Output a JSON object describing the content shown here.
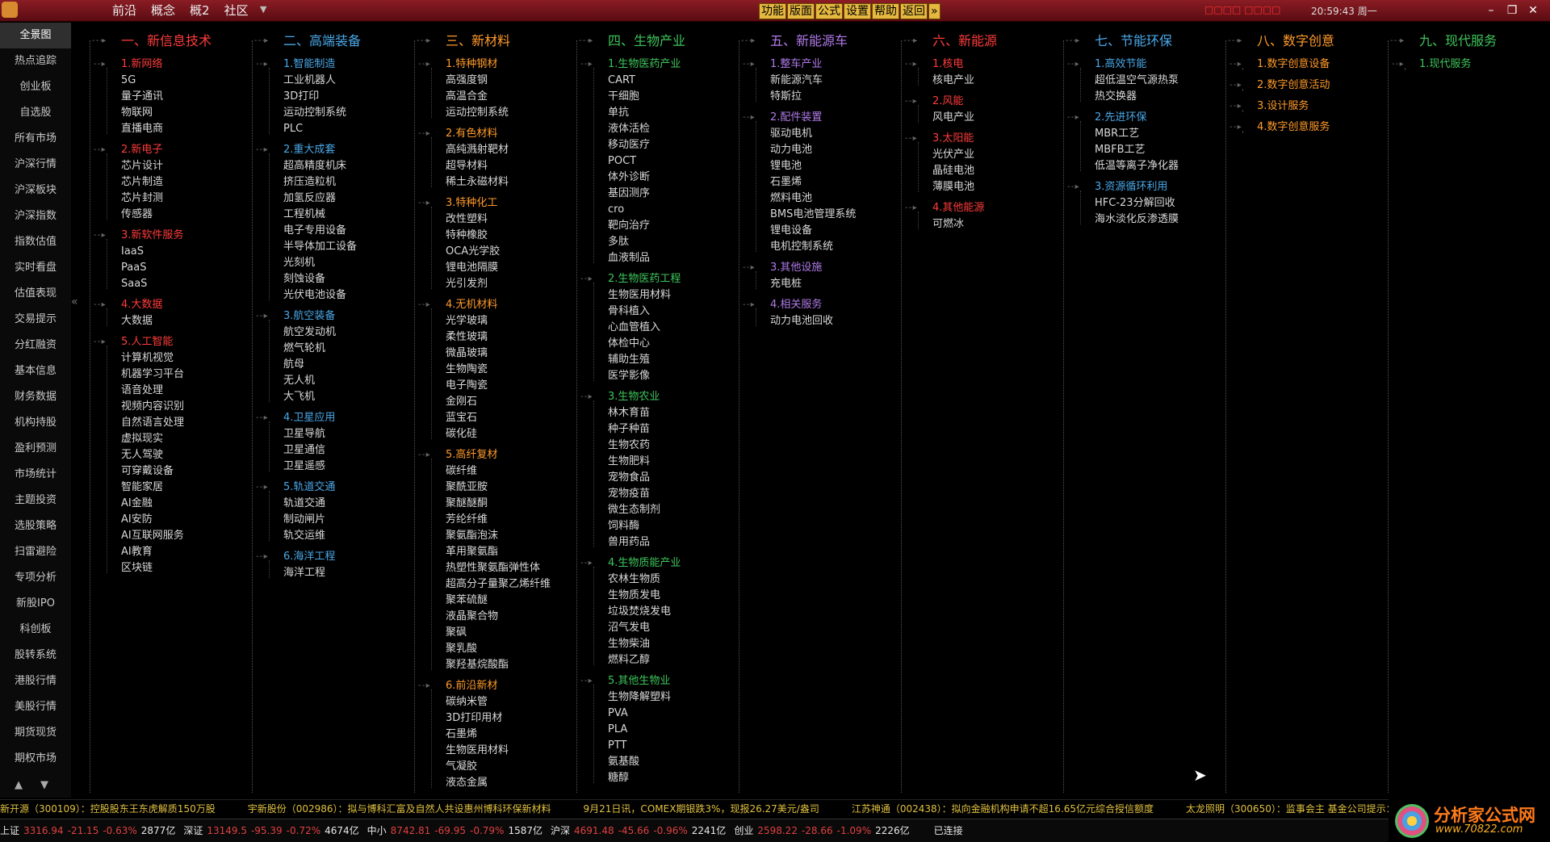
{
  "titlebar": {
    "menu": [
      "前沿",
      "概念",
      "概2",
      "社区"
    ],
    "func_buttons": [
      "功能",
      "版面",
      "公式",
      "设置",
      "帮助",
      "返回"
    ],
    "more_icon": "»",
    "notice": "□□□□ □□□□",
    "clock": "20:59:43 周一",
    "window_controls": [
      "–",
      "❐",
      "✕"
    ]
  },
  "sidebar": {
    "items": [
      "全景图",
      "热点追踪",
      "创业板",
      "自选股",
      "所有市场",
      "沪深行情",
      "沪深板块",
      "沪深指数",
      "指数估值",
      "实时看盘",
      "估值表现",
      "交易提示",
      "分红融资",
      "基本信息",
      "财务数据",
      "机构持股",
      "盈利预测",
      "市场统计",
      "主题投资",
      "选股策略",
      "扫雷避险",
      "专项分析",
      "新股IPO",
      "科创板",
      "股转系统",
      "港股行情",
      "美股行情",
      "期货现货",
      "期权市场"
    ],
    "active": "全景图",
    "collapse_icon": "«",
    "nav_up": "▲",
    "nav_down": "▼"
  },
  "colors": {
    "cat_red": "#ff3b3b",
    "sub_red": "#ff3b3b",
    "cat_blue": "#4aa8e8",
    "sub_blue": "#4aa8e8",
    "cat_orange": "#ff9a2a",
    "sub_orange": "#ff9a2a",
    "cat_green": "#3ec45a",
    "sub_green": "#3ec45a",
    "cat_purple": "#b07ae8",
    "sub_purple": "#b07ae8",
    "cat_teal": "#3ec45a",
    "sub_teal": "#3ec45a"
  },
  "tree": [
    {
      "title": "一、新信息技术",
      "color": "red",
      "subs": [
        {
          "title": "1.新网络",
          "leaves": [
            "5G",
            "量子通讯",
            "物联网",
            "直播电商"
          ]
        },
        {
          "title": "2.新电子",
          "leaves": [
            "芯片设计",
            "芯片制造",
            "芯片封测",
            "传感器"
          ]
        },
        {
          "title": "3.新软件服务",
          "leaves": [
            "IaaS",
            "PaaS",
            "SaaS"
          ]
        },
        {
          "title": "4.大数据",
          "leaves": [
            "大数据"
          ]
        },
        {
          "title": "5.人工智能",
          "leaves": [
            "计算机视觉",
            "机器学习平台",
            "语音处理",
            "视频内容识别",
            "自然语言处理",
            "虚拟现实",
            "无人驾驶",
            "可穿戴设备",
            "智能家居",
            "AI金融",
            "AI安防",
            "AI互联网服务",
            "AI教育",
            "区块链"
          ]
        }
      ]
    },
    {
      "title": "二、高端装备",
      "color": "blue",
      "subs": [
        {
          "title": "1.智能制造",
          "leaves": [
            "工业机器人",
            "3D打印",
            "运动控制系统",
            "PLC"
          ]
        },
        {
          "title": "2.重大成套",
          "leaves": [
            "超高精度机床",
            "挤压造粒机",
            "加氢反应器",
            "工程机械",
            "电子专用设备",
            "半导体加工设备",
            "光刻机",
            "刻蚀设备",
            "光伏电池设备"
          ]
        },
        {
          "title": "3.航空装备",
          "leaves": [
            "航空发动机",
            "燃气轮机",
            "航母",
            "无人机",
            "大飞机"
          ]
        },
        {
          "title": "4.卫星应用",
          "leaves": [
            "卫星导航",
            "卫星通信",
            "卫星遥感"
          ]
        },
        {
          "title": "5.轨道交通",
          "leaves": [
            "轨道交通",
            "制动闸片",
            "轨交运维"
          ]
        },
        {
          "title": "6.海洋工程",
          "leaves": [
            "海洋工程"
          ]
        }
      ]
    },
    {
      "title": "三、新材料",
      "color": "orange",
      "subs": [
        {
          "title": "1.特种钢材",
          "leaves": [
            "高强度钢",
            "高温合金",
            "运动控制系统"
          ]
        },
        {
          "title": "2.有色材料",
          "leaves": [
            "高纯溅射靶材",
            "超导材料",
            "稀土永磁材料"
          ]
        },
        {
          "title": "3.特种化工",
          "leaves": [
            "改性塑料",
            "特种橡胶",
            "OCA光学胶",
            "锂电池隔膜",
            "光引发剂"
          ]
        },
        {
          "title": "4.无机材料",
          "leaves": [
            "光学玻璃",
            "柔性玻璃",
            "微晶玻璃",
            "生物陶瓷",
            "电子陶瓷",
            "金刚石",
            "蓝宝石",
            "碳化硅"
          ]
        },
        {
          "title": "5.高纤复材",
          "leaves": [
            "碳纤维",
            "聚酰亚胺",
            "聚醚醚酮",
            "芳纶纤维",
            "聚氨酯泡沫",
            "革用聚氨酯",
            "热塑性聚氨酯弹性体",
            "超高分子量聚乙烯纤维",
            "聚苯硫醚",
            "液晶聚合物",
            "聚砜",
            "聚乳酸",
            "聚羟基烷酸酯"
          ]
        },
        {
          "title": "6.前沿新材",
          "leaves": [
            "碳纳米管",
            "3D打印用材",
            "石墨烯",
            "生物医用材料",
            "气凝胶",
            "液态金属"
          ]
        }
      ]
    },
    {
      "title": "四、生物产业",
      "color": "green",
      "subs": [
        {
          "title": "1.生物医药产业",
          "leaves": [
            "CART",
            "干细胞",
            "单抗",
            "液体活检",
            "移动医疗",
            "POCT",
            "体外诊断",
            "基因测序",
            "cro",
            "靶向治疗",
            "多肽",
            "血液制品"
          ]
        },
        {
          "title": "2.生物医药工程",
          "leaves": [
            "生物医用材料",
            "骨科植入",
            "心血管植入",
            "体检中心",
            "辅助生殖",
            "医学影像"
          ]
        },
        {
          "title": "3.生物农业",
          "leaves": [
            "林木育苗",
            "种子种苗",
            "生物农药",
            "生物肥料",
            "宠物食品",
            "宠物疫苗",
            "微生态制剂",
            "饲料酶",
            "兽用药品"
          ]
        },
        {
          "title": "4.生物质能产业",
          "leaves": [
            "农林生物质",
            "生物质发电",
            "垃圾焚烧发电",
            "沼气发电",
            "生物柴油",
            "燃料乙醇"
          ]
        },
        {
          "title": "5.其他生物业",
          "leaves": [
            "生物降解塑料",
            "PVA",
            "PLA",
            "PTT",
            "氨基酸",
            "糖醇"
          ]
        }
      ]
    },
    {
      "title": "五、新能源车",
      "color": "purple",
      "subs": [
        {
          "title": "1.整车产业",
          "leaves": [
            "新能源汽车",
            "特斯拉"
          ]
        },
        {
          "title": "2.配件装置",
          "leaves": [
            "驱动电机",
            "动力电池",
            "锂电池",
            "石墨烯",
            "燃料电池",
            "BMS电池管理系统",
            "锂电设备",
            "电机控制系统"
          ]
        },
        {
          "title": "3.其他设施",
          "leaves": [
            "充电桩"
          ]
        },
        {
          "title": "4.相关服务",
          "leaves": [
            "动力电池回收"
          ]
        }
      ]
    },
    {
      "title": "六、新能源",
      "color": "red",
      "subs": [
        {
          "title": "1.核电",
          "leaves": [
            "核电产业"
          ]
        },
        {
          "title": "2.风能",
          "leaves": [
            "风电产业"
          ]
        },
        {
          "title": "3.太阳能",
          "leaves": [
            "光伏产业",
            "晶硅电池",
            "薄膜电池"
          ]
        },
        {
          "title": "4.其他能源",
          "leaves": [
            "可燃冰"
          ]
        }
      ]
    },
    {
      "title": "七、节能环保",
      "color": "blue",
      "subs": [
        {
          "title": "1.高效节能",
          "leaves": [
            "超低温空气源热泵",
            "热交换器"
          ]
        },
        {
          "title": "2.先进环保",
          "leaves": [
            "MBR工艺",
            "MBFB工艺",
            "低温等离子净化器"
          ]
        },
        {
          "title": "3.资源循环利用",
          "leaves": [
            "HFC-23分解回收",
            "海水淡化反渗透膜"
          ]
        }
      ]
    },
    {
      "title": "八、数字创意",
      "color": "orange",
      "subs": [
        {
          "title": "1.数字创意设备",
          "leaves": []
        },
        {
          "title": "2.数字创意活动",
          "leaves": []
        },
        {
          "title": "3.设计服务",
          "leaves": []
        },
        {
          "title": "4.数字创意服务",
          "leaves": []
        }
      ]
    },
    {
      "title": "九、现代服务",
      "color": "green",
      "subs": [
        {
          "title": "1.现代服务",
          "leaves": []
        }
      ]
    }
  ],
  "ticker": [
    "新开源（300109）：控股股东王东虎解质150万股",
    "宇新股份（002986）：拟与博科汇富及自然人共设惠州博科环保新材料",
    "9月21日讯，COMEX期银跌3%，现报26.27美元/盎司",
    "江苏神通（002438）：拟向金融机构申请不超16.65亿元综合授信额度",
    "太龙照明（300650）：监事会主 基金公司提示："
  ],
  "indices": [
    {
      "name": "上证",
      "value": "3316.94",
      "change": "-21.15",
      "pct": "-0.63%",
      "amount": "2877亿"
    },
    {
      "name": "深证",
      "value": "13149.5",
      "change": "-95.39",
      "pct": "-0.72%",
      "amount": "4674亿"
    },
    {
      "name": "中小",
      "value": "8742.81",
      "change": "-69.95",
      "pct": "-0.79%",
      "amount": "1587亿"
    },
    {
      "name": "沪深",
      "value": "4691.48",
      "change": "-45.66",
      "pct": "-0.96%",
      "amount": "2241亿"
    },
    {
      "name": "创业",
      "value": "2598.22",
      "change": "-28.66",
      "pct": "-1.09%",
      "amount": "2226亿"
    }
  ],
  "connection": "已连接",
  "brand": {
    "name": "分析家公式网",
    "url": "www.70822.com"
  }
}
